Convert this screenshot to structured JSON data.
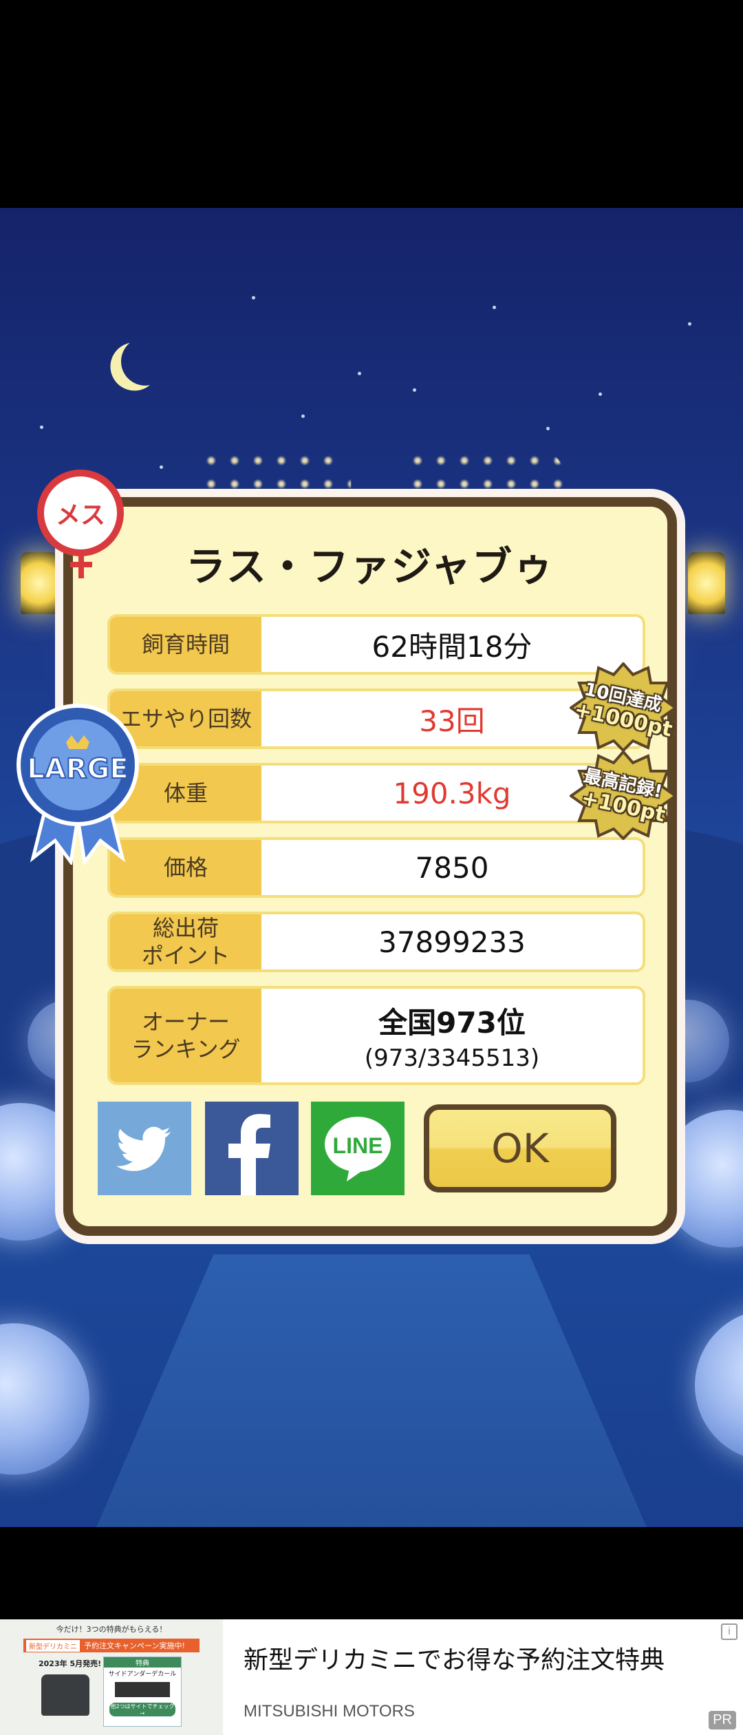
{
  "pet_name": "ラス・ファジャブゥ",
  "gender_badge": "メス",
  "size_ribbon": "LARGE",
  "stats": [
    {
      "label": "飼育時間",
      "value": "62時間18分",
      "highlight": false
    },
    {
      "label": "エサやり回数",
      "value": "33回",
      "highlight": true
    },
    {
      "label": "体重",
      "value": "190.3kg",
      "highlight": true
    },
    {
      "label": "価格",
      "value": "7850",
      "highlight": false
    },
    {
      "label": "総出荷\nポイント",
      "value": "37899233",
      "highlight": false
    },
    {
      "label": "オーナー\nランキング",
      "value": "全国973位",
      "sub": "(973/3345513)",
      "highlight": false
    }
  ],
  "bonuses": [
    {
      "line1": "10回達成",
      "line2": "+1000pt"
    },
    {
      "line1": "最高記録!",
      "line2": "+100pt"
    }
  ],
  "share": {
    "twitter_icon": "twitter-bird-icon",
    "facebook_icon": "facebook-f-icon",
    "line_label": "LINE"
  },
  "ok_label": "OK",
  "colors": {
    "frame": "#5b4428",
    "panel": "#fdf7c5",
    "label_bg": "#f2c84e",
    "highlight_text": "#e03a31",
    "twitter": "#76a9da",
    "facebook": "#3b5898",
    "line": "#2faa3a"
  },
  "ad": {
    "title": "新型デリカミニでお得な予約注文特典",
    "source": "MITSUBISHI MOTORS",
    "pr": "PR",
    "thumb": {
      "banner": "今だけ！3つの特典がもらえる！",
      "tag": "新型デリカミニ",
      "campaign": "予約注文キャンペーン実施中!",
      "release": "2023年 5月発売!",
      "perk_head": "特典",
      "perk_item": "サイドアンダーデカール",
      "cta": "他2つはサイトでチェック →"
    }
  }
}
